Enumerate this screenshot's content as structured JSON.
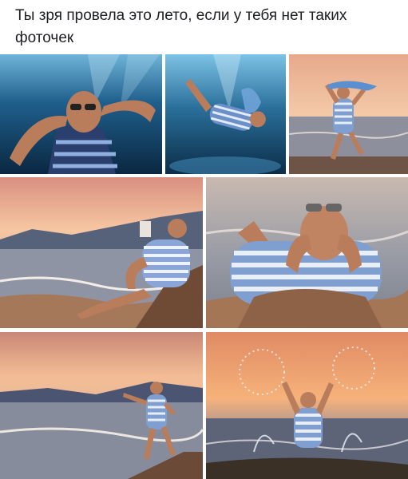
{
  "post": {
    "caption": "Ты зря провела это лето, если у тебя нет таких фоточек"
  },
  "colors": {
    "underwater_deep": "#0b2a44",
    "underwater_light": "#5fa8cf",
    "sunset_sky": "#f4b183",
    "sea": "#8a9fb2",
    "sand": "#b98a62",
    "stripe_blue": "#5b7fc0",
    "skin": "#c58a67"
  }
}
